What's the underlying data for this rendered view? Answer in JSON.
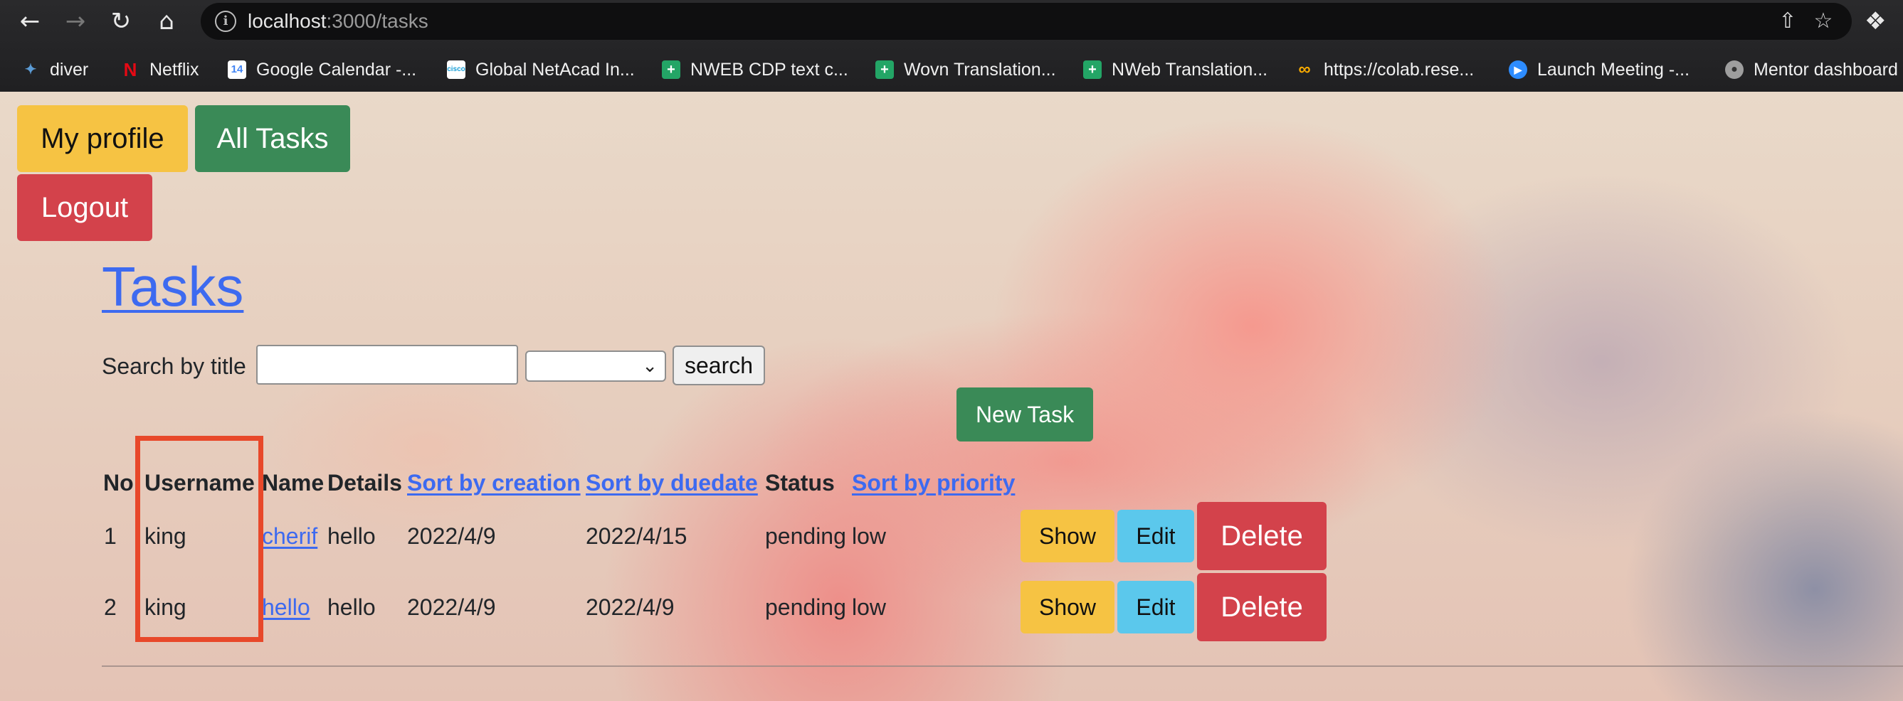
{
  "browser": {
    "url_host": "localhost",
    "url_path": ":3000/tasks",
    "bookmarks": [
      {
        "label": "diver",
        "icon": "diver-icon",
        "color": "#5b9bd5"
      },
      {
        "label": "Netflix",
        "icon": "netflix-icon",
        "color": "#e50914"
      },
      {
        "label": "Google Calendar -...",
        "icon": "google-calendar-icon",
        "color": "#4285f4"
      },
      {
        "label": "Global NetAcad In...",
        "icon": "cisco-icon",
        "color": "#ffffff"
      },
      {
        "label": "NWEB CDP text c...",
        "icon": "google-sheets-icon",
        "color": "#23a566"
      },
      {
        "label": "Wovn Translation...",
        "icon": "google-sheets-icon",
        "color": "#23a566"
      },
      {
        "label": "NWeb Translation...",
        "icon": "google-sheets-icon",
        "color": "#23a566"
      },
      {
        "label": "https://colab.rese...",
        "icon": "colab-icon",
        "color": "#f9ab00"
      },
      {
        "label": "Launch Meeting -...",
        "icon": "zoom-icon",
        "color": "#2d8cff"
      },
      {
        "label": "Mentor dashboard",
        "icon": "globe-icon",
        "color": "#9e9e9e"
      }
    ]
  },
  "nav": {
    "profile_label": "My profile",
    "all_tasks_label": "All Tasks",
    "logout_label": "Logout"
  },
  "page": {
    "title": "Tasks",
    "search_label": "Search by title",
    "search_value": "",
    "filter_selected": "",
    "search_button": "search",
    "new_task_label": "New Task"
  },
  "table": {
    "headers": {
      "no": "No",
      "username": "Username",
      "name": "Name",
      "details": "Details",
      "sort_creation": "Sort by creation",
      "sort_duedate": "Sort by duedate",
      "status": "Status",
      "sort_priority": "Sort by priority"
    },
    "rows": [
      {
        "no": "1",
        "username": "king",
        "name": "cherif",
        "details": "hello",
        "created": "2022/4/9",
        "due": "2022/4/15",
        "status": "pending",
        "priority": "low",
        "show": "Show",
        "edit": "Edit",
        "delete": "Delete"
      },
      {
        "no": "2",
        "username": "king",
        "name": "hello",
        "details": "hello",
        "created": "2022/4/9",
        "due": "2022/4/9",
        "status": "pending",
        "priority": "low",
        "show": "Show",
        "edit": "Edit",
        "delete": "Delete"
      }
    ]
  },
  "colors": {
    "link": "#3d6af0",
    "warning": "#f6c343",
    "success": "#3a8a57",
    "danger": "#d3424b",
    "info": "#5bc8ec",
    "highlight": "#e8482a"
  }
}
